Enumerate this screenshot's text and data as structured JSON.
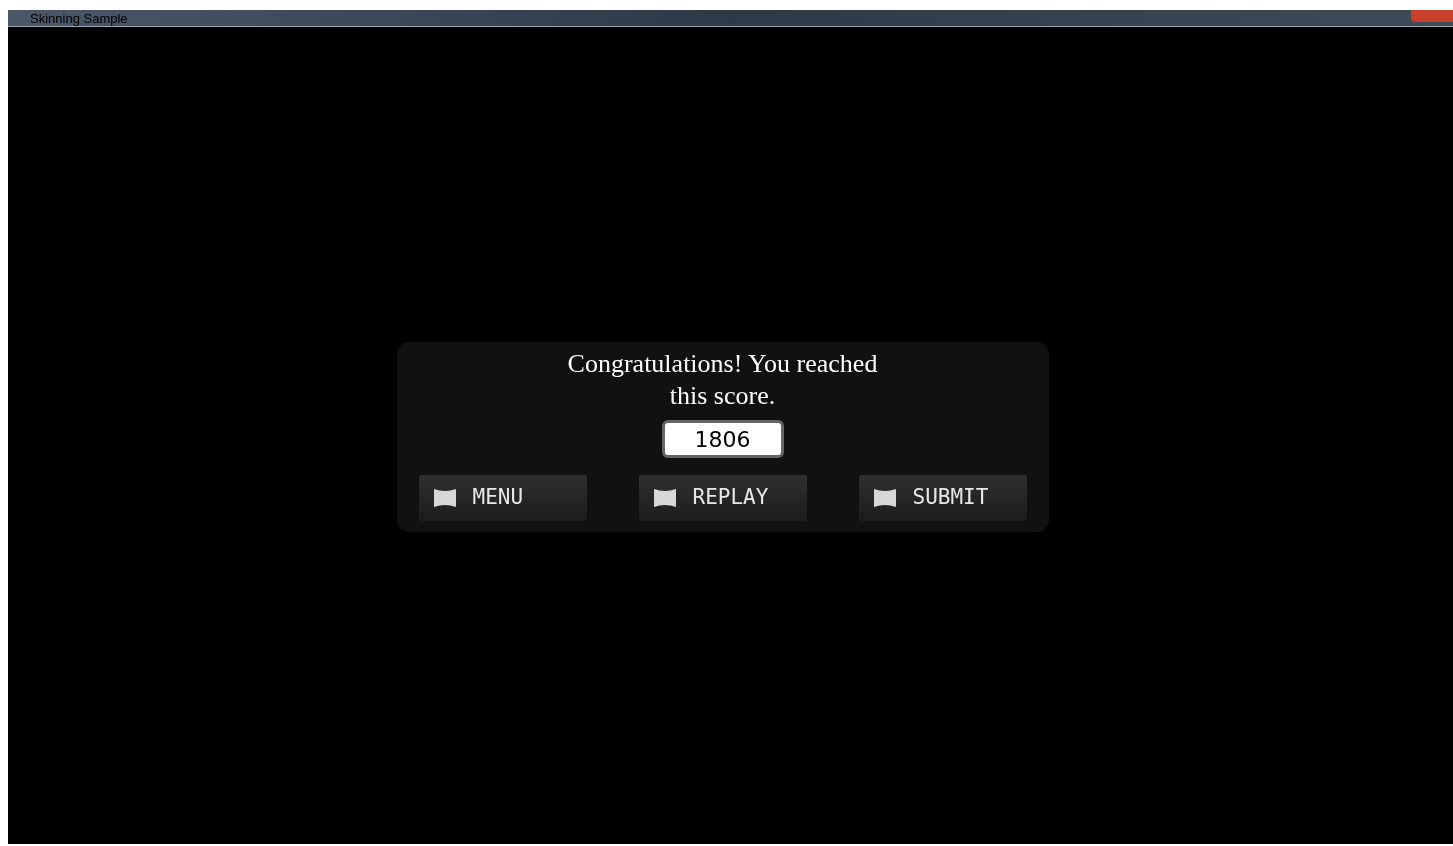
{
  "window": {
    "title": "Skinning Sample"
  },
  "dialog": {
    "message": "Congratulations! You reached this score.",
    "score": "1806",
    "buttons": [
      {
        "label": "MENU"
      },
      {
        "label": "REPLAY"
      },
      {
        "label": "SUBMIT"
      }
    ]
  }
}
